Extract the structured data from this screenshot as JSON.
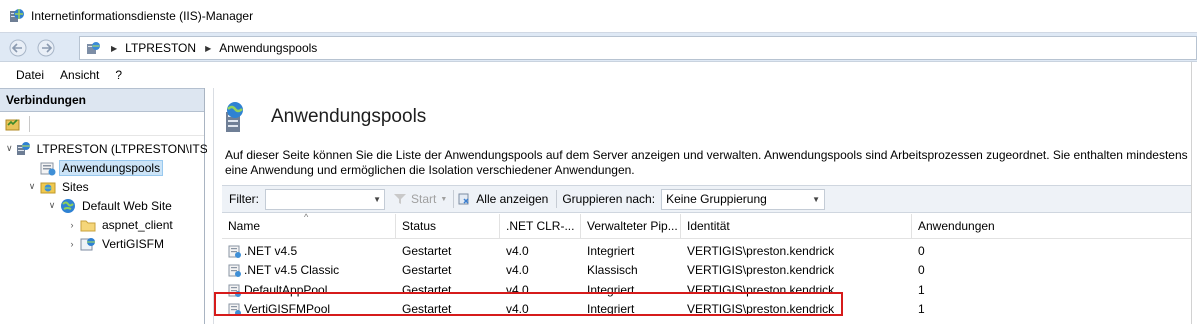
{
  "window": {
    "title": "Internetinformationsdienste (IIS)-Manager"
  },
  "address": {
    "crumbs": [
      "LTPRESTON",
      "Anwendungspools"
    ]
  },
  "menu": [
    "Datei",
    "Ansicht",
    "?"
  ],
  "connections": {
    "header": "Verbindungen",
    "tree": [
      {
        "label": "LTPRESTON (LTPRESTON\\ITSA",
        "icon": "server-icon",
        "twisty": "expanded",
        "depth": 0
      },
      {
        "label": "Anwendungspools",
        "icon": "app-pool-icon",
        "twisty": "none",
        "depth": 1,
        "selected": true
      },
      {
        "label": "Sites",
        "icon": "sites-folder-icon",
        "twisty": "expanded",
        "depth": 1
      },
      {
        "label": "Default Web Site",
        "icon": "globe-icon",
        "twisty": "expanded",
        "depth": 2
      },
      {
        "label": "aspnet_client",
        "icon": "folder-icon",
        "twisty": "collapsed",
        "depth": 3
      },
      {
        "label": "VertiGISFM",
        "icon": "web-app-icon",
        "twisty": "collapsed",
        "depth": 3
      }
    ]
  },
  "page": {
    "title": "Anwendungspools",
    "description": "Auf dieser Seite können Sie die Liste der Anwendungspools auf dem Server anzeigen und verwalten. Anwendungspools sind Arbeitsprozessen zugeordnet. Sie enthalten mindestens eine Anwendung und ermöglichen die Isolation verschiedener Anwendungen."
  },
  "filterbar": {
    "filter_label": "Filter:",
    "filter_value": "",
    "start_label": "Start",
    "show_all_label": "Alle anzeigen",
    "group_label": "Gruppieren nach:",
    "group_value": "Keine Gruppierung"
  },
  "grid": {
    "columns": [
      "Name",
      "Status",
      ".NET CLR-...",
      "Verwalteter Pip...",
      "Identität",
      "Anwendungen"
    ],
    "rows": [
      {
        "name": ".NET v4.5",
        "status": "Gestartet",
        "clr": "v4.0",
        "pipeline": "Integriert",
        "identity": "VERTIGIS\\preston.kendrick",
        "apps": "0"
      },
      {
        "name": ".NET v4.5 Classic",
        "status": "Gestartet",
        "clr": "v4.0",
        "pipeline": "Klassisch",
        "identity": "VERTIGIS\\preston.kendrick",
        "apps": "0"
      },
      {
        "name": "DefaultAppPool",
        "status": "Gestartet",
        "clr": "v4.0",
        "pipeline": "Integriert",
        "identity": "VERTIGIS\\preston.kendrick",
        "apps": "1"
      },
      {
        "name": "VertiGISFMPool",
        "status": "Gestartet",
        "clr": "v4.0",
        "pipeline": "Integriert",
        "identity": "VERTIGIS\\preston.kendrick",
        "apps": "1"
      }
    ],
    "highlighted_row": "VertiGISFMPool"
  },
  "colors": {
    "highlight": "#d61b1b",
    "selection": "#cce4f7",
    "panel_header": "#dde6f1"
  }
}
